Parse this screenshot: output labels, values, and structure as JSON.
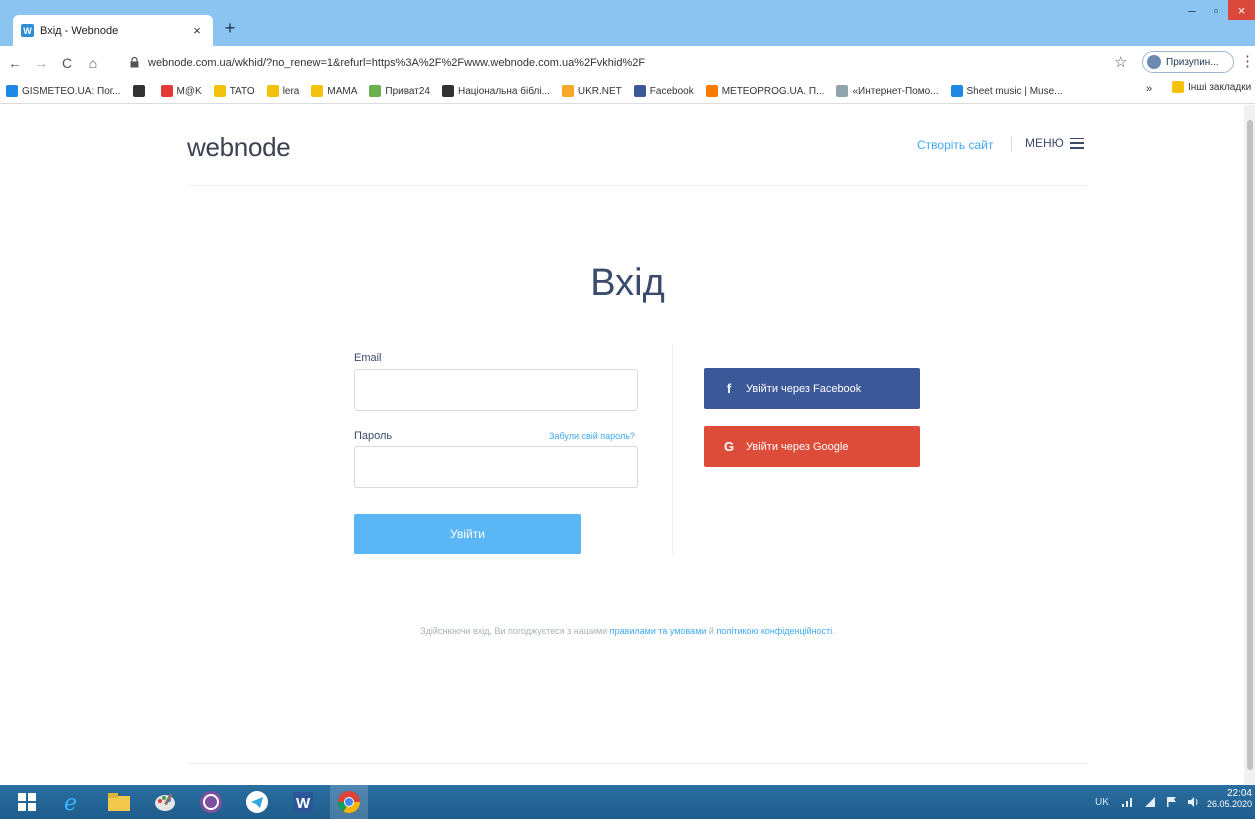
{
  "browser": {
    "tab": {
      "title": "Вхід - Webnode",
      "favicon_letter": "W"
    },
    "url": "webnode.com.ua/wkhid/?no_renew=1&refurl=https%3A%2F%2Fwww.webnode.com.ua%2Fvkhid%2F",
    "profile_name": "Призупин...",
    "bookmarks": [
      {
        "label": "GISMETEO.UA: Пог...",
        "color": "#1e88e5"
      },
      {
        "label": "",
        "color": "#333333"
      },
      {
        "label": "M@K",
        "color": "#e53935"
      },
      {
        "label": "TATO",
        "color": "#f4c20d"
      },
      {
        "label": "lera",
        "color": "#f4c20d"
      },
      {
        "label": "MAMA",
        "color": "#f4c20d"
      },
      {
        "label": "Приват24",
        "color": "#6ab04c"
      },
      {
        "label": "Національна біблі...",
        "color": "#333333"
      },
      {
        "label": "UKR.NET",
        "color": "#f9a825"
      },
      {
        "label": "Facebook",
        "color": "#3b5998"
      },
      {
        "label": "METEOPROG.UA. П...",
        "color": "#f57c00"
      },
      {
        "label": "«Интернет-Помо...",
        "color": "#90a4ae"
      },
      {
        "label": "Sheet music | Muse...",
        "color": "#1e88e5"
      }
    ],
    "bookmarks_more": "»",
    "bookmarks_other": "Інші закладки"
  },
  "site": {
    "logo": "webnode",
    "create_site": "Створіть сайт",
    "menu_label": "МЕНЮ"
  },
  "login": {
    "title": "Вхід",
    "email_label": "Email",
    "email_value": "",
    "password_label": "Пароль",
    "password_value": "",
    "forgot_link": "Забули свій пароль?",
    "submit": "Увійти",
    "facebook_icon_glyph": "f",
    "facebook_button": "Увійти через Facebook",
    "google_icon_glyph": "G",
    "google_button": "Увійти через Google"
  },
  "legal": {
    "prefix": "Здійснюючи вхід, Ви погоджуєтеся з нашими ",
    "terms_link": "правилами та умовами",
    "middle": " й ",
    "privacy_link": "політикою конфіденційності",
    "suffix": "."
  },
  "taskbar": {
    "apps": [
      "start",
      "internet-explorer",
      "file-explorer",
      "paint",
      "viber",
      "telegram",
      "word",
      "chrome"
    ],
    "lang": "UK",
    "time": "22:04",
    "date": "26.05.2020"
  },
  "colors": {
    "accent": "#3fa9f5",
    "primary_button": "#5ab6f5",
    "facebook": "#3b5998",
    "google": "#dd4b39",
    "heading": "#3b4b6b"
  }
}
